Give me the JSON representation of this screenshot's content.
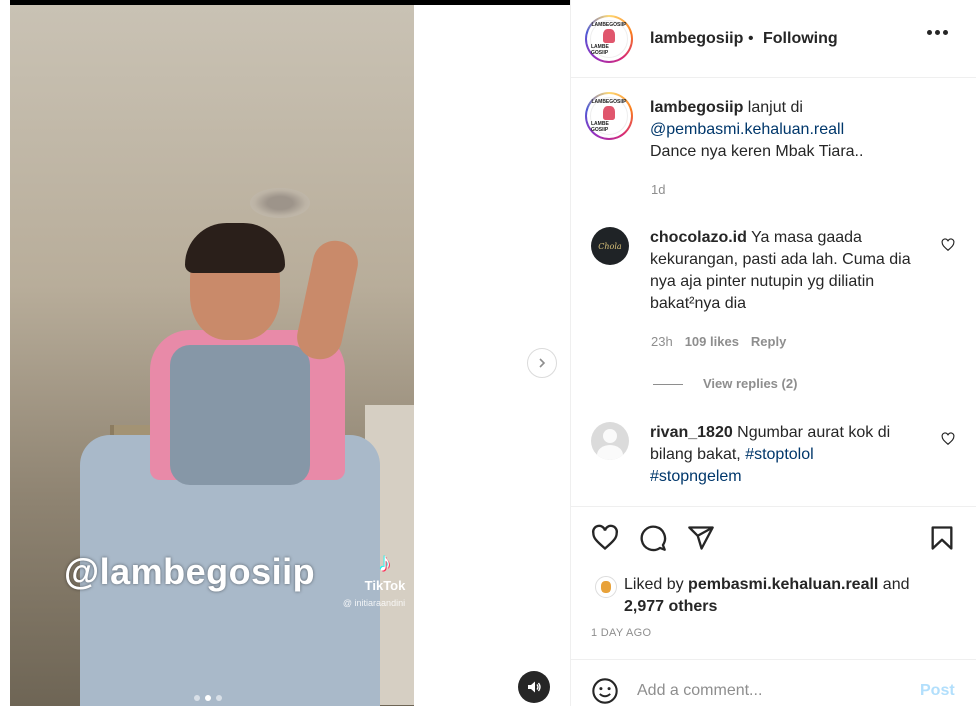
{
  "media": {
    "watermark": "@lambegosiip",
    "tiktok_label": "TikTok",
    "tiktok_handle": "@ initiaraandini",
    "carousel": {
      "count": 3,
      "active_index": 1
    }
  },
  "header": {
    "username": "lambegosiip",
    "separator": "•",
    "follow_status": "Following",
    "avatar_text_top": "LAMBEGOSIIP",
    "avatar_text_bottom": "LAMBE GOSIIP"
  },
  "caption": {
    "username": "lambegosiip",
    "text_before_mention": " lanjut di",
    "mention": "@pembasmi.kehaluan.reall",
    "text_after": "Dance nya keren Mbak Tiara..",
    "time": "1d"
  },
  "comments": [
    {
      "username": "chocolazo.id",
      "avatar_label": "Chola",
      "text": " Ya masa gaada kekurangan, pasti ada lah. Cuma dia nya aja pinter nutupin yg diliatin bakat²nya dia",
      "time": "23h",
      "likes": "109 likes",
      "reply": "Reply",
      "view_replies": "View replies (2)"
    },
    {
      "username": "rivan_1820",
      "text": " Ngumbar aurat kok di bilang bakat, ",
      "hashtag1": "#stoptolol",
      "hashtag2": "#stopngelem"
    }
  ],
  "likes": {
    "prefix": "Liked by ",
    "liker": "pembasmi.kehaluan.reall",
    "middle": " and",
    "others": "2,977 others"
  },
  "post_time": "1 DAY AGO",
  "add_comment": {
    "placeholder": "Add a comment...",
    "post_label": "Post"
  },
  "colors": {
    "link": "#00376b",
    "muted": "#8e8e8e",
    "post_button": "#b2dffc",
    "text": "#262626"
  },
  "icons": [
    "more-icon",
    "next-icon",
    "audio-icon",
    "heart-icon",
    "comment-icon",
    "share-icon",
    "bookmark-icon",
    "emoji-icon"
  ]
}
